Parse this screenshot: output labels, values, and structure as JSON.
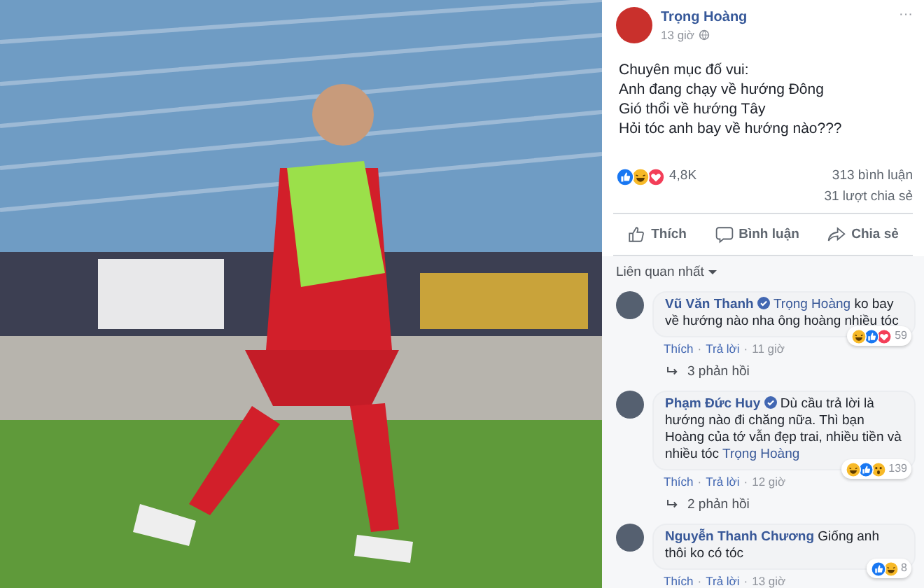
{
  "post": {
    "author": "Trọng Hoàng",
    "time": "13 giờ",
    "menu": "···",
    "lines": [
      "Chuyên mục đố vui:",
      "Anh đang chạy về hướng Đông",
      "Gió thổi về hướng Tây",
      "Hỏi tóc anh bay về hướng nào???"
    ],
    "reactions": [
      {
        "kind": "like"
      },
      {
        "kind": "haha"
      },
      {
        "kind": "love"
      }
    ],
    "reaction_count": "4,8K",
    "comments_count": "313 bình luận",
    "shares_count": "31 lượt chia sẻ"
  },
  "actions": [
    {
      "kind": "like",
      "label": "Thích"
    },
    {
      "kind": "comment",
      "label": "Bình luận"
    },
    {
      "kind": "share",
      "label": "Chia sẻ"
    }
  ],
  "sort": {
    "label": "Liên quan nhất"
  },
  "comments": [
    {
      "author": "Vũ Văn Thanh",
      "verified": true,
      "parts": [
        {
          "kind": "mention",
          "text": "Trọng Hoàng"
        },
        {
          "kind": "plain",
          "text": " ko bay về hướng nào nha ông hoàng nhiều tóc"
        }
      ],
      "reactions": [
        {
          "kind": "haha"
        },
        {
          "kind": "like"
        },
        {
          "kind": "love"
        }
      ],
      "reaction_count": "59",
      "like": "Thích",
      "separator": "·",
      "reply": "Trả lời",
      "time": "11 giờ",
      "replies": "3 phản hồi"
    },
    {
      "author": "Phạm Đức Huy",
      "verified": true,
      "parts": [
        {
          "kind": "plain",
          "text": "Dù cầu trả lời là hướng nào đi chăng nữa. Thì bạn Hoàng của tớ vẫn đẹp trai, nhiều tiền và nhiều tóc "
        },
        {
          "kind": "mention",
          "text": "Trọng Hoàng"
        }
      ],
      "reactions": [
        {
          "kind": "haha"
        },
        {
          "kind": "like"
        },
        {
          "kind": "wow"
        }
      ],
      "reaction_count": "139",
      "like": "Thích",
      "separator": "·",
      "reply": "Trả lời",
      "time": "12 giờ",
      "replies": "2 phản hồi"
    },
    {
      "author": "Nguyễn Thanh Chương",
      "verified": false,
      "parts": [
        {
          "kind": "plain",
          "text": "Giống anh thôi ko có tóc"
        }
      ],
      "reactions": [
        {
          "kind": "like"
        },
        {
          "kind": "haha"
        }
      ],
      "reaction_count": "8",
      "like": "Thích",
      "separator": "·",
      "reply": "Trả lời",
      "time": "13 giờ"
    }
  ]
}
